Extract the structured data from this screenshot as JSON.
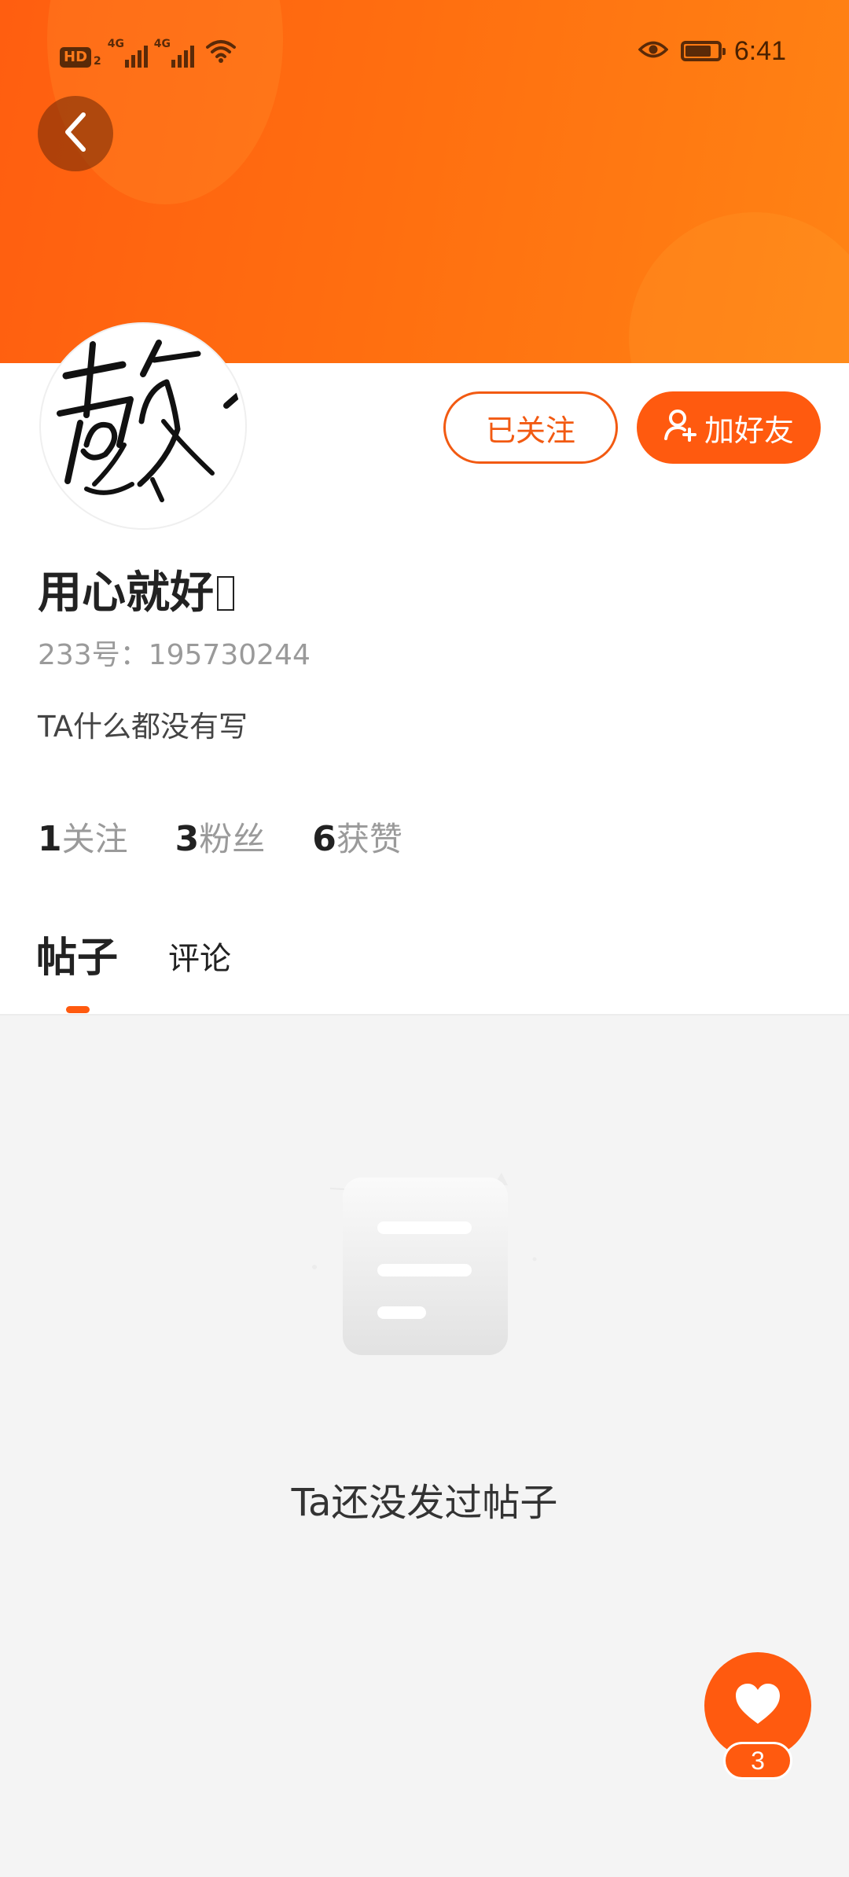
{
  "status_bar": {
    "hd_label": "HD",
    "hd_sub": "2",
    "network_1": "4G",
    "network_2": "4G",
    "time": "6:41"
  },
  "profile": {
    "username": "用心就好",
    "username_suffix": "",
    "id_label": "233号：",
    "id_value": "195730244",
    "bio": "TA什么都没有写"
  },
  "actions": {
    "follow_label": "已关注",
    "add_friend_label": "加好友"
  },
  "stats": {
    "following_count": "1",
    "following_label": "关注",
    "fans_count": "3",
    "fans_label": "粉丝",
    "likes_count": "6",
    "likes_label": "获赞"
  },
  "tabs": [
    {
      "label": "帖子",
      "active": true
    },
    {
      "label": "评论",
      "active": false
    }
  ],
  "empty_state": {
    "message": "Ta还没发过帖子"
  },
  "like_fab": {
    "count": "3"
  },
  "colors": {
    "accent": "#ff5a0f",
    "header_start": "#ff5e10",
    "header_end": "#ff8314",
    "content_bg": "#f4f4f4"
  },
  "icons": [
    "back-arrow-icon",
    "eye-icon",
    "battery-icon",
    "wifi-icon",
    "signal-icon",
    "add-user-icon",
    "document-icon",
    "heart-icon"
  ]
}
